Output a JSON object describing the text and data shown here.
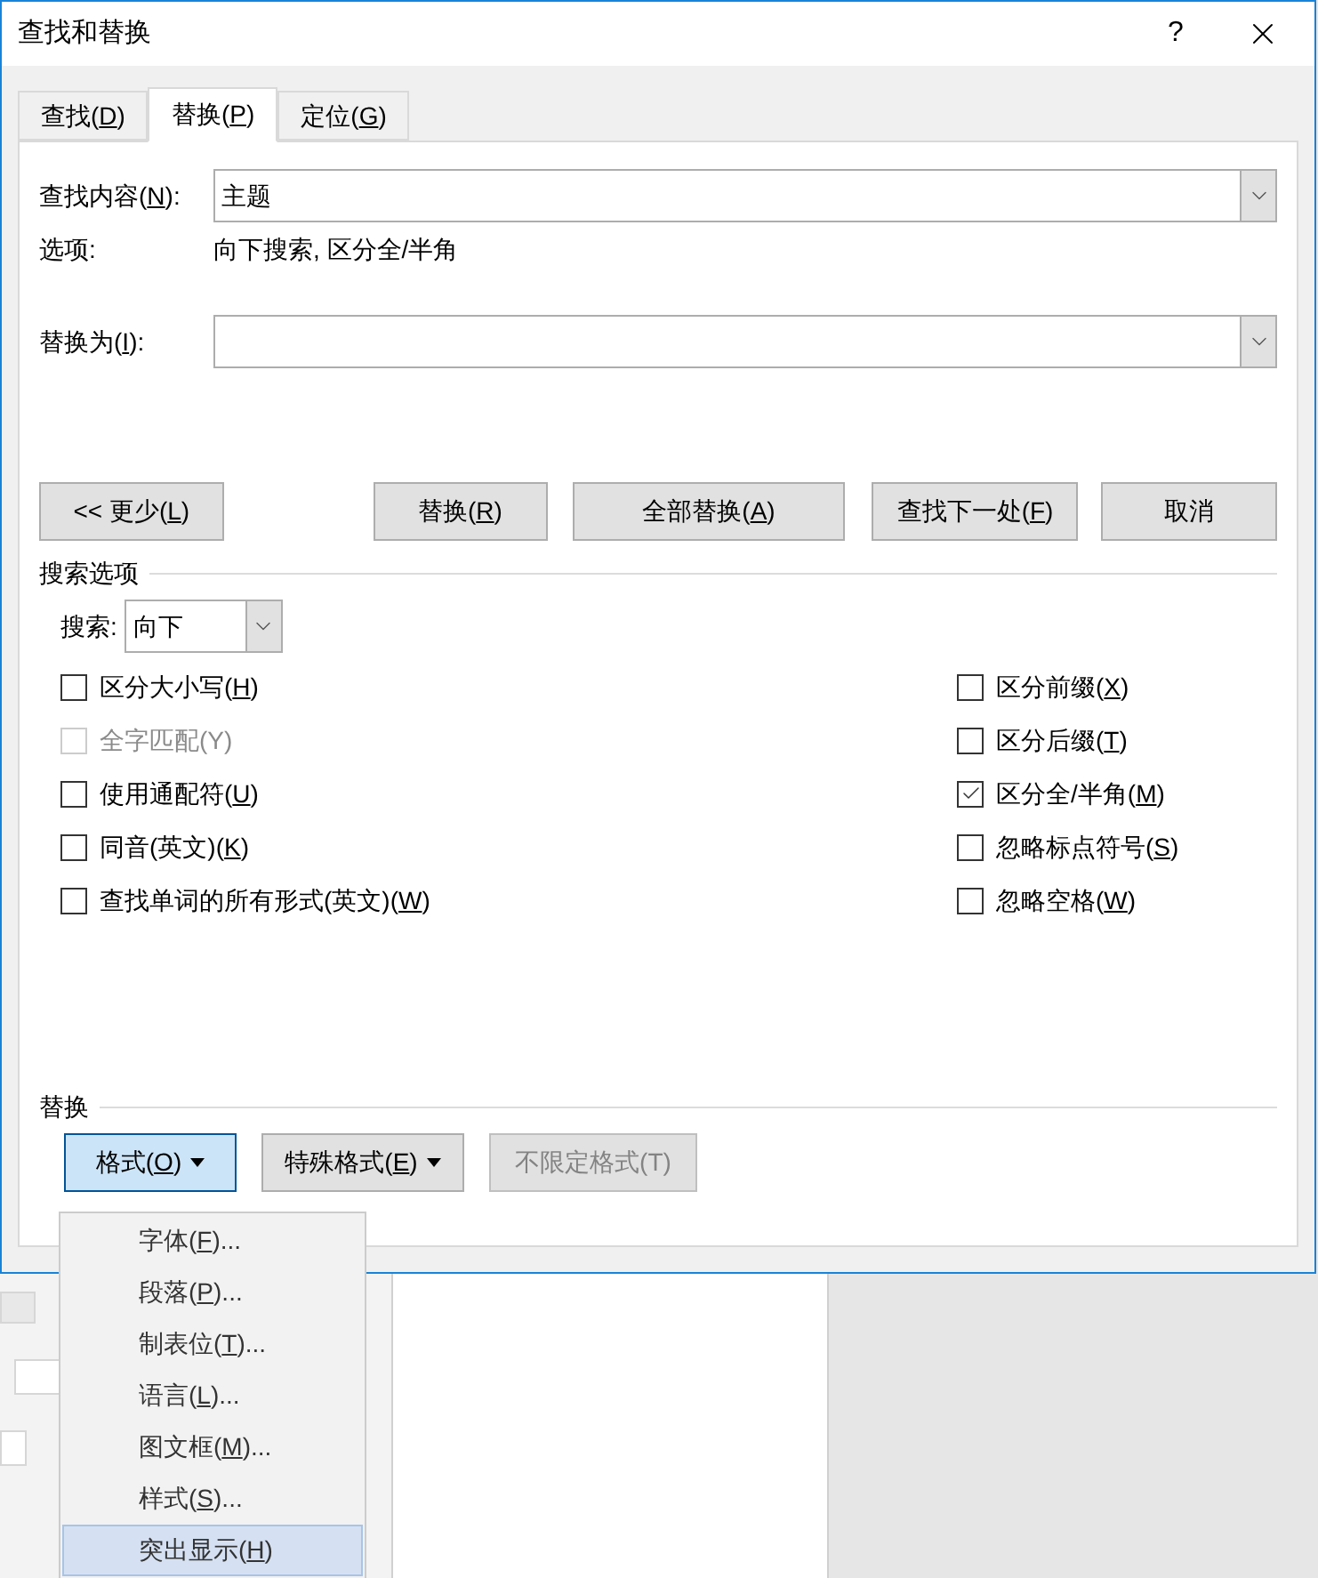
{
  "window": {
    "title": "查找和替换",
    "help": "?"
  },
  "tabs": [
    {
      "label": [
        "查找(",
        "D",
        ")"
      ],
      "selected": false
    },
    {
      "label": [
        "替换(",
        "P",
        ")"
      ],
      "selected": true
    },
    {
      "label": [
        "定位(",
        "G",
        ")"
      ],
      "selected": false
    }
  ],
  "find": {
    "label": [
      "查找内容(",
      "N",
      "):"
    ],
    "value": "主题"
  },
  "options": {
    "label": "选项:",
    "value": "向下搜索, 区分全/半角"
  },
  "replace": {
    "label": [
      "替换为(",
      "I",
      "):"
    ]
  },
  "buttons": [
    {
      "label": [
        "<< 更少(",
        "L",
        ")"
      ]
    },
    {
      "label": [
        "替换(",
        "R",
        ")"
      ]
    },
    {
      "label": [
        "全部替换(",
        "A",
        ")"
      ]
    },
    {
      "label": [
        "查找下一处(",
        "F",
        ")"
      ]
    },
    {
      "label": "取消"
    }
  ],
  "search_options": {
    "heading": "搜索选项",
    "search_label": "搜索:",
    "direction": "向下"
  },
  "checkboxes_left": [
    {
      "label": [
        "区分大小写(",
        "H",
        ")"
      ],
      "checked": false,
      "disabled": false
    },
    {
      "label": "全字匹配(Y)",
      "checked": false,
      "disabled": true
    },
    {
      "label": [
        "使用通配符(",
        "U",
        ")"
      ],
      "checked": false,
      "disabled": false
    },
    {
      "label": [
        "同音(英文)(",
        "K",
        ")"
      ],
      "checked": false,
      "disabled": false
    },
    {
      "label": [
        "查找单词的所有形式(英文)(",
        "W",
        ")"
      ],
      "checked": false,
      "disabled": false
    }
  ],
  "checkboxes_right": [
    {
      "label": [
        "区分前缀(",
        "X",
        ")"
      ],
      "checked": false,
      "disabled": false
    },
    {
      "label": [
        "区分后缀(",
        "T",
        ")"
      ],
      "checked": false,
      "disabled": false
    },
    {
      "label": [
        "区分全/半角(",
        "M",
        ")"
      ],
      "checked": true,
      "disabled": false
    },
    {
      "label": [
        "忽略标点符号(",
        "S",
        ")"
      ],
      "checked": false,
      "disabled": false
    },
    {
      "label": [
        "忽略空格(",
        "W",
        ")"
      ],
      "checked": false,
      "disabled": false
    }
  ],
  "replace_section": {
    "heading": "替换",
    "buttons": [
      {
        "label": [
          "格式(",
          "O",
          ")"
        ],
        "kind": "menu",
        "selected": true,
        "disabled": false
      },
      {
        "label": [
          "特殊格式(",
          "E",
          ")"
        ],
        "kind": "menu",
        "selected": false,
        "disabled": false
      },
      {
        "label": "不限定格式(T)",
        "kind": "plain",
        "selected": false,
        "disabled": true
      }
    ]
  },
  "format_menu": {
    "items": [
      {
        "label": [
          "字体(",
          "F",
          ")..."
        ],
        "selected": false
      },
      {
        "label": [
          "段落(",
          "P",
          ")..."
        ],
        "selected": false
      },
      {
        "label": [
          "制表位(",
          "T",
          ")..."
        ],
        "selected": false
      },
      {
        "label": [
          "语言(",
          "L",
          ")..."
        ],
        "selected": false
      },
      {
        "label": [
          "图文框(",
          "M",
          ")..."
        ],
        "selected": false
      },
      {
        "label": [
          "样式(",
          "S",
          ")..."
        ],
        "selected": false
      },
      {
        "label": [
          "突出显示(",
          "H",
          ")"
        ],
        "selected": true
      }
    ]
  }
}
